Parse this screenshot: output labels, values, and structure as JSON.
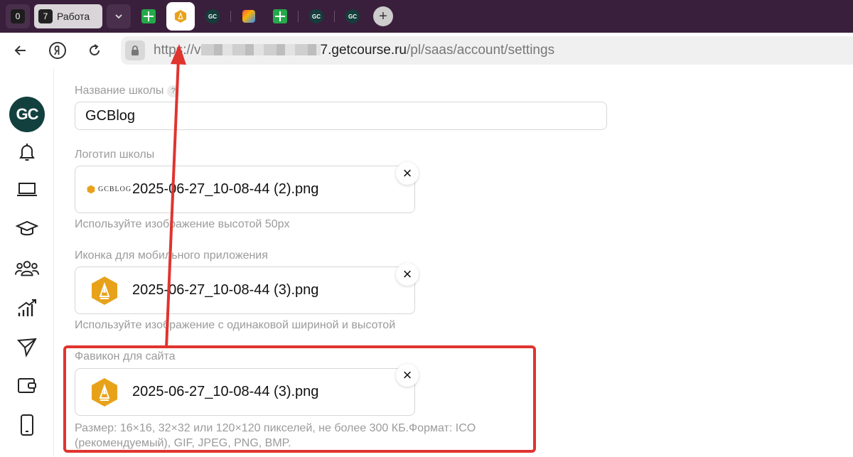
{
  "tabbar": {
    "group_zero_count": "0",
    "group_work_count": "7",
    "group_work_label": "Работа",
    "icons": [
      "green-plus-icon",
      "getcourse-hex-icon",
      "gc-icon",
      "multicolor-app-icon",
      "green-plus-icon",
      "gc-icon",
      "gc-icon"
    ],
    "new_tab_label": "+"
  },
  "addressbar": {
    "url_prefix": "https://v",
    "url_host": "7.getcourse.ru",
    "url_path": "/pl/saas/account/settings"
  },
  "sidebar": {
    "logo_text": "GC",
    "items": [
      "bell-icon",
      "laptop-icon",
      "graduation-cap-icon",
      "users-icon",
      "chart-growth-icon",
      "send-icon",
      "wallet-icon",
      "mobile-icon"
    ]
  },
  "form": {
    "school_name_label": "Название школы",
    "school_name_help": "?",
    "school_name_value": "GCBlog",
    "logo_label": "Логотип школы",
    "logo_file": "2025-06-27_10-08-44 (2).png",
    "logo_preview_text": "GCBLOG",
    "logo_hint": "Используйте изображение высотой 50px",
    "app_icon_label": "Иконка для мобильного приложения",
    "app_icon_file": "2025-06-27_10-08-44 (3).png",
    "app_icon_hint": "Используйте изображение с одинаковой шириной и высотой",
    "favicon_label": "Фавикон для сайта",
    "favicon_file": "2025-06-27_10-08-44 (3).png",
    "favicon_hint_line1": "Размер: 16×16, 32×32 или 120×120 пикселей, не более 300 КБ.Формат: ICO",
    "favicon_hint_line2": "(рекомендуемый), GIF, JPEG, PNG, BMP.",
    "remove_symbol": "×"
  },
  "colors": {
    "tabbar_bg": "#3a1f3c",
    "brand_orange": "#e8a21a",
    "brand_dark": "#12403f",
    "highlight_red": "#e0342f"
  }
}
